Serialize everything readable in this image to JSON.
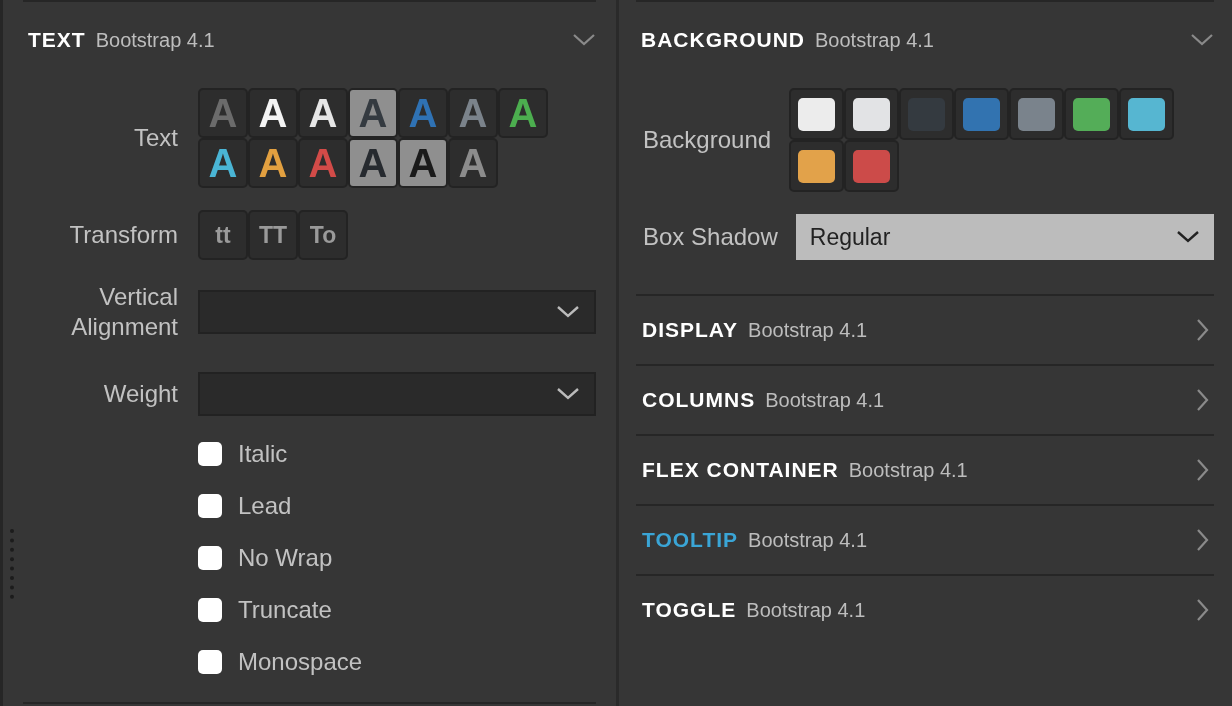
{
  "text_panel": {
    "title": "TEXT",
    "subtitle": "Bootstrap 4.1",
    "expanded": true,
    "text_colors": {
      "label": "Text",
      "swatches": [
        {
          "letter": "A",
          "color": "#6b6b6b"
        },
        {
          "letter": "A",
          "color": "#f4f4f4"
        },
        {
          "letter": "A",
          "color": "#e6e6e6"
        },
        {
          "letter": "A",
          "color": "#343a40"
        },
        {
          "letter": "A",
          "color": "#2f72b4"
        },
        {
          "letter": "A",
          "color": "#7b838b"
        },
        {
          "letter": "A",
          "color": "#4cae4f"
        },
        {
          "letter": "A",
          "color": "#4ab5d5"
        },
        {
          "letter": "A",
          "color": "#e2a040"
        },
        {
          "letter": "A",
          "color": "#d24b48"
        },
        {
          "letter": "A",
          "color": "#262a2f"
        },
        {
          "letter": "A",
          "color": "#1a1a1a"
        },
        {
          "letter": "A",
          "color": "#8c8c8c"
        }
      ]
    },
    "transform": {
      "label": "Transform",
      "buttons": [
        "tt",
        "TT",
        "To"
      ]
    },
    "selects": [
      {
        "label": "Vertical Alignment"
      },
      {
        "label": "Weight"
      }
    ],
    "checkboxes": [
      {
        "label": "Italic",
        "checked": false
      },
      {
        "label": "Lead",
        "checked": false
      },
      {
        "label": "No Wrap",
        "checked": false
      },
      {
        "label": "Truncate",
        "checked": false
      },
      {
        "label": "Monospace",
        "checked": false
      }
    ]
  },
  "right_panel": {
    "background": {
      "title": "BACKGROUND",
      "subtitle": "Bootstrap 4.1",
      "expanded": true,
      "swatch_label": "Background",
      "swatches": [
        {
          "color": "#ececec"
        },
        {
          "color": "#e2e3e5"
        },
        {
          "color": "#343a40"
        },
        {
          "color": "#3273b0"
        },
        {
          "color": "#7a838c"
        },
        {
          "color": "#54ad58"
        },
        {
          "color": "#56b6d1"
        },
        {
          "color": "#e2a24a"
        },
        {
          "color": "#cc4b49"
        }
      ],
      "box_shadow": {
        "label": "Box Shadow",
        "value": "Regular"
      }
    },
    "sections": [
      {
        "title": "DISPLAY",
        "subtitle": "Bootstrap 4.1",
        "expanded": false,
        "hovered": false
      },
      {
        "title": "COLUMNS",
        "subtitle": "Bootstrap 4.1",
        "expanded": false,
        "hovered": false
      },
      {
        "title": "FLEX CONTAINER",
        "subtitle": "Bootstrap 4.1",
        "expanded": false,
        "hovered": false
      },
      {
        "title": "TOOLTIP",
        "subtitle": "Bootstrap 4.1",
        "expanded": false,
        "hovered": true
      },
      {
        "title": "TOGGLE",
        "subtitle": "Bootstrap 4.1",
        "expanded": false,
        "hovered": false
      }
    ]
  }
}
